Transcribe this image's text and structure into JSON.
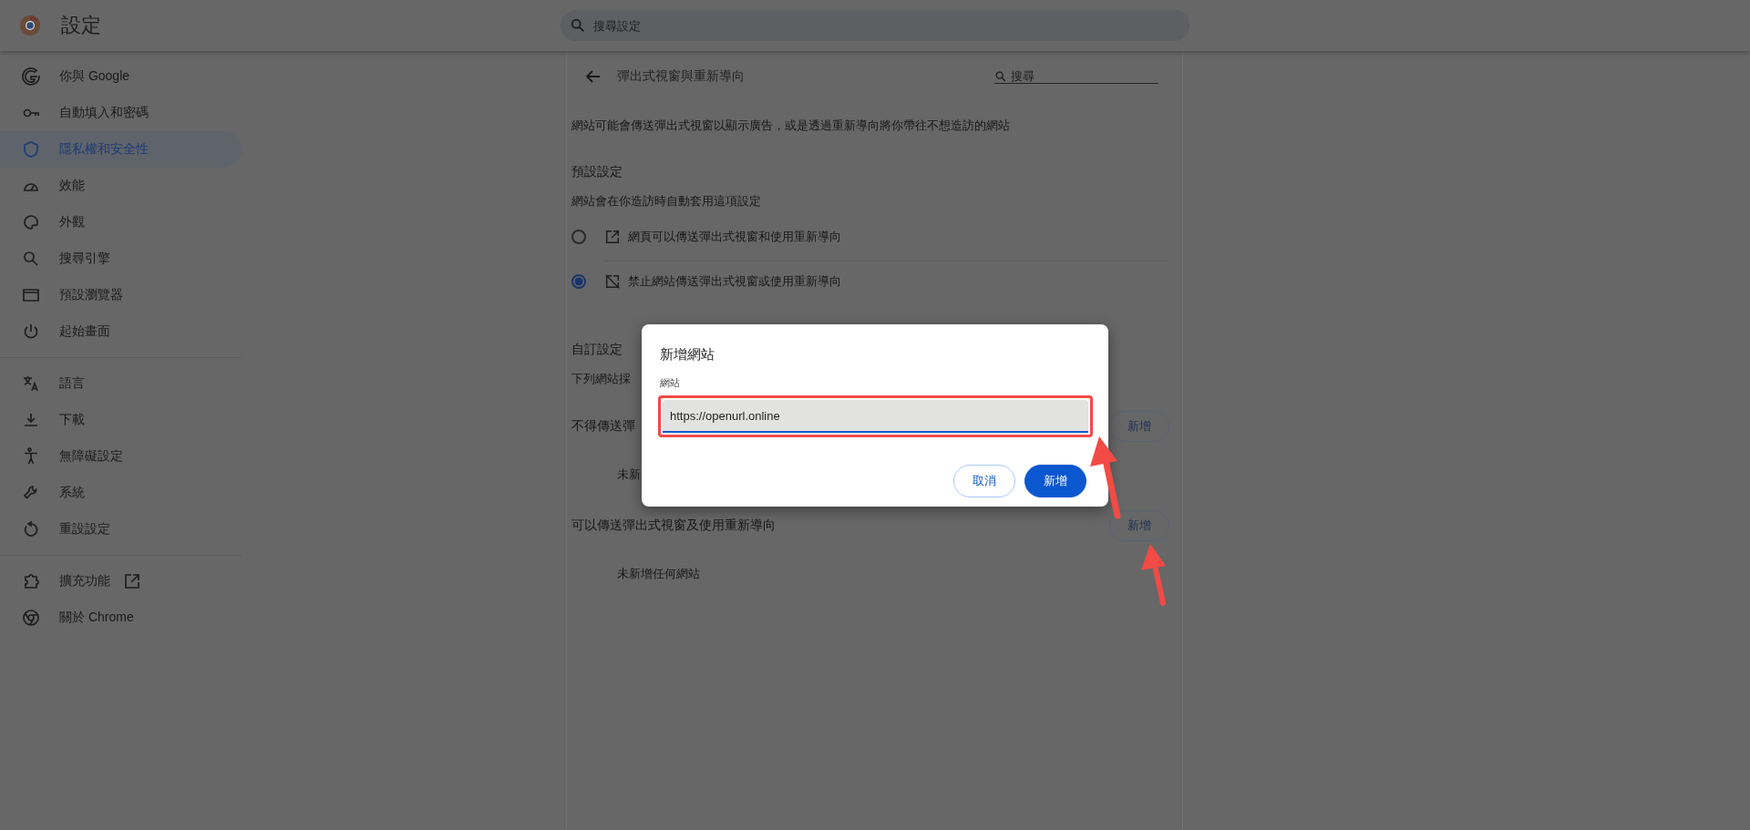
{
  "header": {
    "title": "設定",
    "search": {
      "placeholder": "搜尋設定"
    }
  },
  "sidebar": {
    "groups": [
      {
        "items": [
          {
            "label": "你與 Google",
            "selected": false,
            "external_link": false
          },
          {
            "label": "自動填入和密碼",
            "selected": false,
            "external_link": false
          },
          {
            "label": "隱私權和安全性",
            "selected": true,
            "external_link": false
          },
          {
            "label": "效能",
            "selected": false,
            "external_link": false
          },
          {
            "label": "外觀",
            "selected": false,
            "external_link": false
          },
          {
            "label": "搜尋引擎",
            "selected": false,
            "external_link": false
          },
          {
            "label": "預設瀏覽器",
            "selected": false,
            "external_link": false
          },
          {
            "label": "起始畫面",
            "selected": false,
            "external_link": false
          }
        ]
      },
      {
        "items": [
          {
            "label": "語言",
            "selected": false,
            "external_link": false
          },
          {
            "label": "下載",
            "selected": false,
            "external_link": false
          },
          {
            "label": "無障礙設定",
            "selected": false,
            "external_link": false
          },
          {
            "label": "系統",
            "selected": false,
            "external_link": false
          },
          {
            "label": "重設設定",
            "selected": false,
            "external_link": false
          }
        ]
      },
      {
        "items": [
          {
            "label": "擴充功能",
            "selected": false,
            "external_link": true
          },
          {
            "label": "關於 Chrome",
            "selected": false,
            "external_link": false
          }
        ]
      }
    ]
  },
  "page": {
    "title": "彈出式視窗與重新導向",
    "search": {
      "placeholder": "搜尋"
    },
    "description": "網站可能會傳送彈出式視窗以顯示廣告，或是透過重新導向將你帶往不想造訪的網站",
    "default_heading": "預設設定",
    "default_note": "網站會在你造訪時自動套用這項設定",
    "options": [
      {
        "label": "網頁可以傳送彈出式視窗和使用重新導向",
        "selected": false,
        "kind": "allow"
      },
      {
        "label": "禁止網站傳送彈出式視窗或使用重新導向",
        "selected": true,
        "kind": "block"
      }
    ],
    "custom_heading": "自訂設定",
    "custom_note": "下列網站採",
    "sections": [
      {
        "title": "不得傳送彈",
        "button": "新增",
        "empty": "未新"
      },
      {
        "title": "可以傳送彈出式視窗及使用重新導向",
        "button": "新增",
        "empty": "未新增任何網站"
      }
    ]
  },
  "dialog": {
    "title": "新增網站",
    "field": {
      "label": "網站",
      "value": "https://openurl.online"
    },
    "buttons": [
      {
        "label": "取消",
        "kind": "secondary"
      },
      {
        "label": "新增",
        "kind": "primary"
      }
    ]
  }
}
